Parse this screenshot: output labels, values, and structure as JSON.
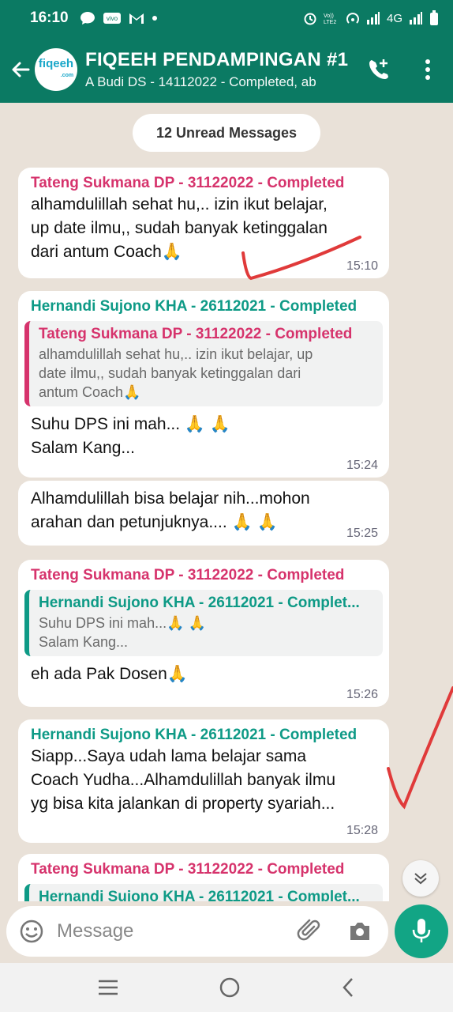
{
  "status_bar": {
    "time": "16:10",
    "network": "4G"
  },
  "header": {
    "title": "FIQEEH PENDAMPINGAN #1",
    "subtitle": "A Budi DS - 14112022 - Completed, ab",
    "avatar_logo": "fiqeeh",
    "avatar_logo_suffix": ".com",
    "accent_color": "#0b7a63"
  },
  "unread_banner": "12 Unread Messages",
  "messages": [
    {
      "sender": "Tateng Sukmana DP - 31122022 - Completed",
      "text_lines": [
        "alhamdulillah sehat hu,.. izin ikut belajar,",
        "up date ilmu,, sudah banyak ketinggalan",
        "dari antum Coach🙏"
      ],
      "time": "15:10"
    },
    {
      "sender": "Hernandi Sujono KHA - 26112021 - Completed",
      "quote": {
        "sender": "Tateng Sukmana DP - 31122022 - Completed",
        "lines": [
          "alhamdulillah sehat hu,.. izin ikut belajar, up",
          "date ilmu,, sudah banyak ketinggalan dari",
          "antum Coach🙏"
        ]
      },
      "text_lines": [
        "Suhu DPS ini mah... 🙏 🙏",
        "Salam Kang..."
      ],
      "time": "15:24"
    },
    {
      "text_lines": [
        "Alhamdulillah bisa belajar nih...mohon",
        "arahan dan petunjuknya.... 🙏 🙏"
      ],
      "time": "15:25"
    },
    {
      "sender": "Tateng Sukmana DP - 31122022 - Completed",
      "quote": {
        "sender": "Hernandi Sujono KHA - 26112021 - Complet...",
        "lines": [
          "Suhu DPS ini mah...🙏 🙏",
          "Salam Kang..."
        ]
      },
      "text_lines": [
        "eh ada Pak Dosen🙏"
      ],
      "time": "15:26"
    },
    {
      "sender": "Hernandi Sujono KHA - 26112021 - Completed",
      "text_lines": [
        "Siapp...Saya udah lama belajar sama",
        "Coach Yudha...Alhamdulillah banyak ilmu",
        "yg bisa kita jalankan di property syariah..."
      ],
      "time": "15:28"
    },
    {
      "sender": "Tateng Sukmana DP - 31122022 - Completed",
      "quote_partial_sender": "Hernandi Sujono KHA - 26112021 - Complet..."
    }
  ],
  "input": {
    "placeholder": "Message"
  },
  "colors": {
    "pink_sender": "#d6336c",
    "teal_sender": "#0e9a86",
    "annotation_red": "#e03a3a"
  }
}
